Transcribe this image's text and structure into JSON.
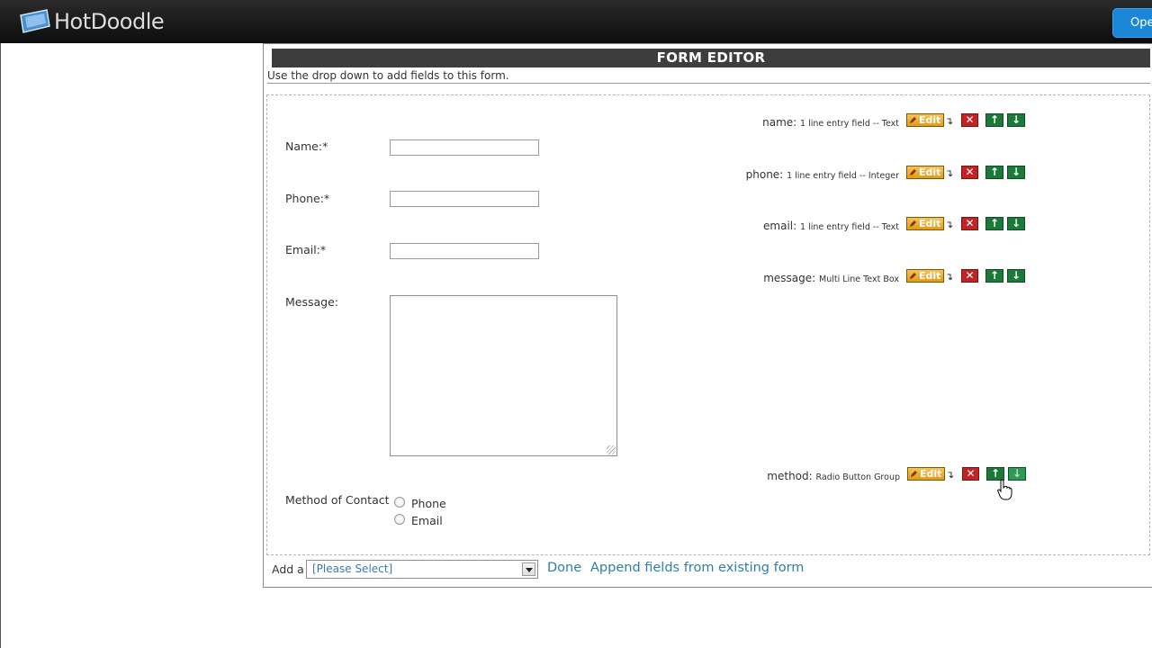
{
  "app": {
    "logo_text": "HotDoodle",
    "open_button_label": "Ope"
  },
  "editor": {
    "title": "FORM EDITOR",
    "hint": "Use the drop down to add fields to this form."
  },
  "form_fields": {
    "name_label": "Name:*",
    "phone_label": "Phone:*",
    "email_label": "Email:*",
    "message_label": "Message:",
    "method_label": "Method of Contact",
    "method_options": [
      "Phone",
      "Email"
    ]
  },
  "field_controls": [
    {
      "key": "name:",
      "type": "1 line entry field -- Text"
    },
    {
      "key": "phone:",
      "type": "1 line entry field -- Integer"
    },
    {
      "key": "email:",
      "type": "1 line entry field -- Text"
    },
    {
      "key": "message:",
      "type": "Multi Line Text Box"
    },
    {
      "key": "method:",
      "type": "Radio Button Group"
    }
  ],
  "controls": {
    "edit_label": "Edit",
    "edit_arrow": "↴",
    "delete_icon": "close-icon",
    "up_icon": "arrow-up-icon",
    "down_icon": "arrow-down-icon"
  },
  "add_row": {
    "label": "Add a",
    "select_value": "[Please Select]",
    "done_link": "Done",
    "append_link": "Append fields from existing form"
  },
  "colors": {
    "header_bg": "#3d3d3d",
    "edit_button": "#f0ad2c",
    "delete_button": "#c02424",
    "move_button": "#1b7a39",
    "link": "#2d7fa8",
    "open_button": "#1b86d6"
  }
}
